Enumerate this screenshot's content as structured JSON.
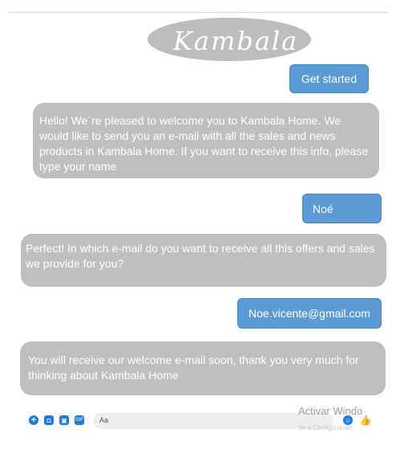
{
  "logo": {
    "text": "Kambala"
  },
  "messages": {
    "get_started": "Get started",
    "welcome": "Hello! We´re pleased to welcome you to Kambala Home. We would like to send you an e-mail with all the sales and news products in Kambala Home. If you want to receive this info, please type your name",
    "user_name": "Noé",
    "ask_email": "Perfect! In which e-mail do you want to receive all this offers and sales we provide for you?",
    "user_email": "Noe.vicente@gmail.com",
    "confirmation": "You will receive our welcome e-mail soon, thank you very much for thinking about Kambala Home"
  },
  "composer": {
    "placeholder": "Aa",
    "icons": [
      "plus-icon",
      "camera-icon",
      "image-icon",
      "gif-icon",
      "emoji-icon",
      "like-icon"
    ]
  },
  "watermark": {
    "line1": "Activar Windo",
    "line2": "Ve a Configuración"
  },
  "colors": {
    "accent": "#5b9bd5",
    "incoming_bubble": "#bfbfbf",
    "messenger_blue": "#1a7ae8"
  }
}
